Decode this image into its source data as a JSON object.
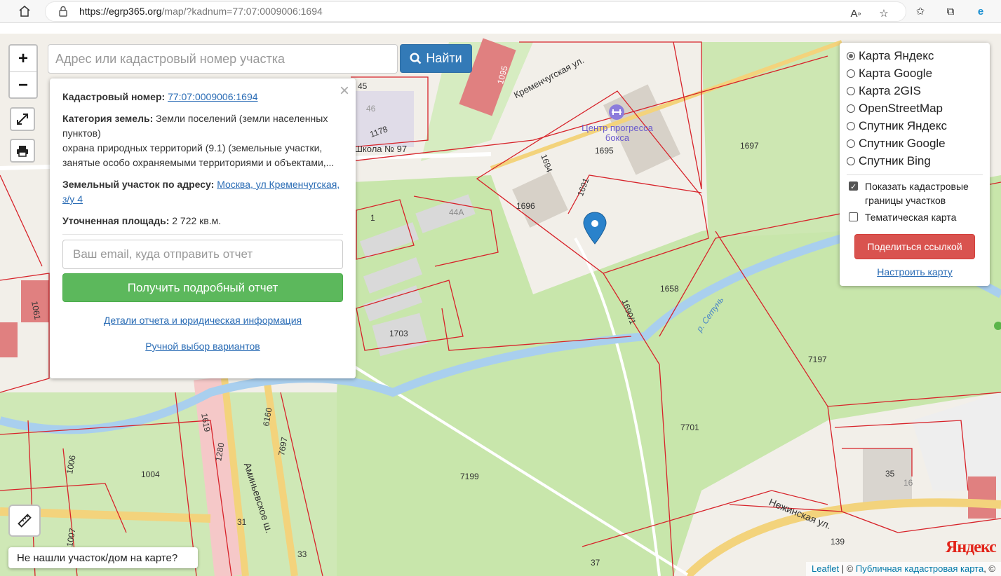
{
  "browser": {
    "url_host": "https://egrp365.org",
    "url_path": "/map/?kadnum=77:07:0009006:1694"
  },
  "search": {
    "placeholder": "Адрес или кадастровый номер участка",
    "button_label": "Найти"
  },
  "zoom": {
    "in": "+",
    "out": "−"
  },
  "popup": {
    "close": "×",
    "cadastral_label": "Кадастровый номер:",
    "cadastral_value": "77:07:0009006:1694",
    "category_label": "Категория земель:",
    "category_value": "Земли поселений (земли населенных пунктов)",
    "category_detail": "охрана природных территорий (9.1) (земельные участки, занятые особо охраняемыми территориями и объектами,...",
    "address_label": "Земельный участок по адресу:",
    "address_value": "Москва, ул Кременчугская, з/у 4",
    "area_label": "Уточненная площадь:",
    "area_value": "2 722 кв.м.",
    "email_placeholder": "Ваш email, куда отправить отчет",
    "report_button": "Получить подробный отчет",
    "details_link": "Детали отчета и юридическая информация",
    "manual_link": "Ручной выбор вариантов"
  },
  "layers": {
    "options": [
      {
        "label": "Карта Яндекс",
        "selected": true
      },
      {
        "label": "Карта Google",
        "selected": false
      },
      {
        "label": "Карта 2GIS",
        "selected": false
      },
      {
        "label": "OpenStreetMap",
        "selected": false
      },
      {
        "label": "Спутник Яндекс",
        "selected": false
      },
      {
        "label": "Спутник Google",
        "selected": false
      },
      {
        "label": "Спутник Bing",
        "selected": false
      }
    ],
    "show_borders_label": "Показать кадастровые границы участков",
    "show_borders_checked": true,
    "thematic_label": "Тематическая карта",
    "thematic_checked": false,
    "share_button": "Поделиться ссылкой",
    "setup_link": "Настроить карту"
  },
  "not_found": "Не нашли участок/дом на карте?",
  "attribution": {
    "leaflet": "Leaflet",
    "separator": " | © ",
    "source": "Публичная кадастровая карта",
    "suffix": ", ©"
  },
  "map_labels": {
    "poi_name": "Центр прогресса бокса",
    "school": "Школа № 97",
    "street_kremenchug": "Кременчугская ул.",
    "street_nezhin": "Нежинская ул.",
    "river": "р. Сетунь",
    "street_aminev": "Аминьевское ш.",
    "yandex": "Яндекс",
    "parcels": [
      "1095",
      "45",
      "46",
      "1178",
      "1694",
      "1695",
      "1697",
      "1691",
      "1696",
      "1",
      "44А",
      "1658",
      "1690/1",
      "1703",
      "1061",
      "7197",
      "7701",
      "7199",
      "1004",
      "1006",
      "1280",
      "1619",
      "6160",
      "7697",
      "31",
      "33",
      "37",
      "35",
      "16",
      "139",
      "1007"
    ]
  },
  "colors": {
    "parcel_border": "#d7232a",
    "green_area": "#c8e6ab",
    "river": "#a9cfee",
    "search_button": "#337ab7",
    "report_button": "#5cb85c",
    "share_button": "#d9534f",
    "marker": "#2a82cb"
  }
}
